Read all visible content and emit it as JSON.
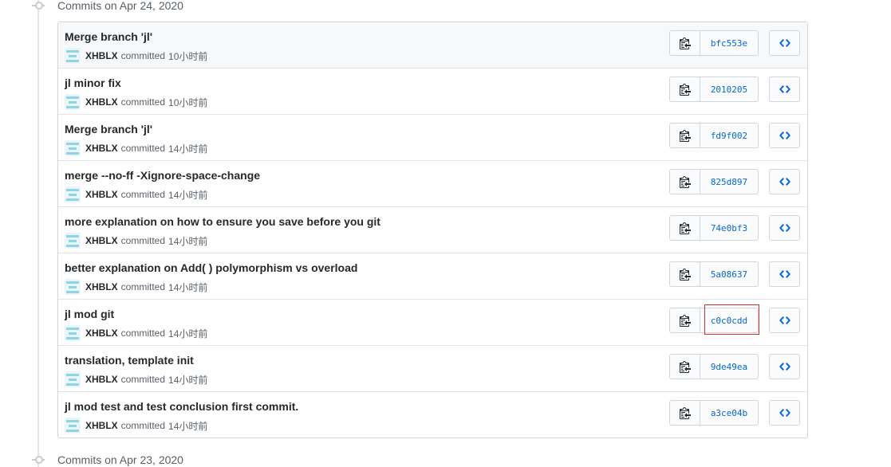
{
  "groups": {
    "top_label": "Commits on Apr 24, 2020",
    "bottom_label": "Commits on Apr 23, 2020"
  },
  "committed_word": "committed",
  "commits": [
    {
      "title": "Merge branch 'jl'",
      "author": "XHBLX",
      "time": "10小时前",
      "sha": "bfc553e"
    },
    {
      "title": "jl minor fix",
      "author": "XHBLX",
      "time": "10小时前",
      "sha": "2010205"
    },
    {
      "title": "Merge branch 'jl'",
      "author": "XHBLX",
      "time": "14小时前",
      "sha": "fd9f002"
    },
    {
      "title": "merge --no-ff -Xignore-space-change",
      "author": "XHBLX",
      "time": "14小时前",
      "sha": "825d897"
    },
    {
      "title": "more explanation on how to ensure you save before you git",
      "author": "XHBLX",
      "time": "14小时前",
      "sha": "74e0bf3"
    },
    {
      "title": "better explanation on Add( ) polymorphism vs overload",
      "author": "XHBLX",
      "time": "14小时前",
      "sha": "5a08637"
    },
    {
      "title": "jl mod git",
      "author": "XHBLX",
      "time": "14小时前",
      "sha": "c0c0cdd"
    },
    {
      "title": "translation, template init",
      "author": "XHBLX",
      "time": "14小时前",
      "sha": "9de49ea"
    },
    {
      "title": "jl mod test and test conclusion first commit.",
      "author": "XHBLX",
      "time": "14小时前",
      "sha": "a3ce04b"
    }
  ],
  "icons": {
    "timeline": "git-commit-icon",
    "copy": "clipboard-icon",
    "browse": "code-icon",
    "avatar": "identicon"
  },
  "colors": {
    "sha_link": "#0366d6",
    "highlight_box": "#d0312d",
    "avatar": "#8fd3e6"
  }
}
